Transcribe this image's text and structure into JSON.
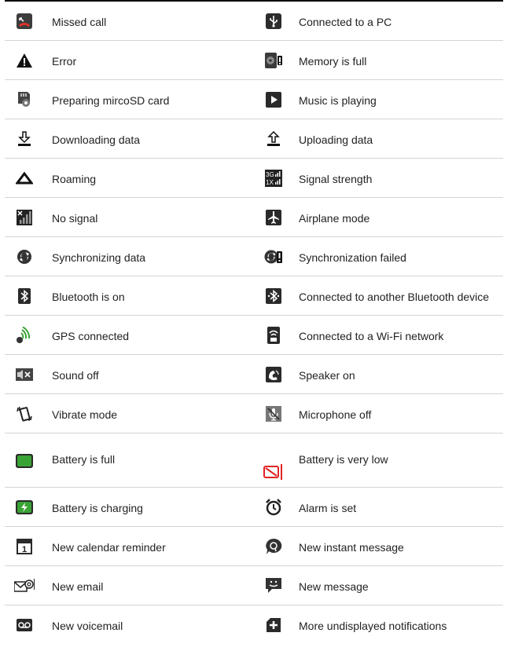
{
  "rows": [
    {
      "left": {
        "icon": "missed-call-icon",
        "label": "Missed call"
      },
      "right": {
        "icon": "usb-icon",
        "label": "Connected to a PC"
      }
    },
    {
      "left": {
        "icon": "error-icon",
        "label": "Error"
      },
      "right": {
        "icon": "memory-full-icon",
        "label": "Memory is full"
      }
    },
    {
      "left": {
        "icon": "sd-card-prepare-icon",
        "label": "Preparing mircoSD card"
      },
      "right": {
        "icon": "music-play-icon",
        "label": "Music is playing"
      }
    },
    {
      "left": {
        "icon": "download-icon",
        "label": "Downloading data"
      },
      "right": {
        "icon": "upload-icon",
        "label": "Uploading data"
      }
    },
    {
      "left": {
        "icon": "roaming-icon",
        "label": "Roaming"
      },
      "right": {
        "icon": "signal-strength-icon",
        "label": "Signal strength",
        "badge": [
          "3G",
          "1X"
        ]
      }
    },
    {
      "left": {
        "icon": "no-signal-icon",
        "label": "No signal"
      },
      "right": {
        "icon": "airplane-icon",
        "label": "Airplane mode"
      }
    },
    {
      "left": {
        "icon": "sync-icon",
        "label": "Synchronizing data"
      },
      "right": {
        "icon": "sync-failed-icon",
        "label": "Synchronization failed"
      }
    },
    {
      "left": {
        "icon": "bluetooth-icon",
        "label": "Bluetooth is on"
      },
      "right": {
        "icon": "bluetooth-connected-icon",
        "label": "Connected to another Bluetooth device"
      }
    },
    {
      "left": {
        "icon": "gps-icon",
        "label": "GPS connected"
      },
      "right": {
        "icon": "wifi-icon",
        "label": "Connected to a Wi-Fi network"
      }
    },
    {
      "left": {
        "icon": "sound-off-icon",
        "label": "Sound off"
      },
      "right": {
        "icon": "speaker-icon",
        "label": "Speaker on"
      }
    },
    {
      "left": {
        "icon": "vibrate-icon",
        "label": "Vibrate mode"
      },
      "right": {
        "icon": "mic-off-icon",
        "label": "Microphone off"
      }
    },
    {
      "left": {
        "icon": "battery-full-icon",
        "label": "Battery is full"
      },
      "right": {
        "icon": "battery-low-icon",
        "label": "Battery is very low"
      }
    },
    {
      "left": {
        "icon": "battery-charging-icon",
        "label": "Battery is charging"
      },
      "right": {
        "icon": "alarm-icon",
        "label": "Alarm is set"
      }
    },
    {
      "left": {
        "icon": "calendar-icon",
        "label": "New calendar reminder",
        "badge": "1"
      },
      "right": {
        "icon": "instant-message-icon",
        "label": "New instant message"
      }
    },
    {
      "left": {
        "icon": "email-icon",
        "label": "New email"
      },
      "right": {
        "icon": "message-icon",
        "label": "New message"
      }
    },
    {
      "left": {
        "icon": "voicemail-icon",
        "label": "New voicemail"
      },
      "right": {
        "icon": "more-notifications-icon",
        "label": "More undisplayed notifications"
      }
    }
  ],
  "colors": {
    "border_top": "#000000",
    "divider": "#d4d4d4",
    "battery_green": "#3aa335",
    "battery_low_red": "#e02424",
    "icon_dark": "#333333"
  }
}
